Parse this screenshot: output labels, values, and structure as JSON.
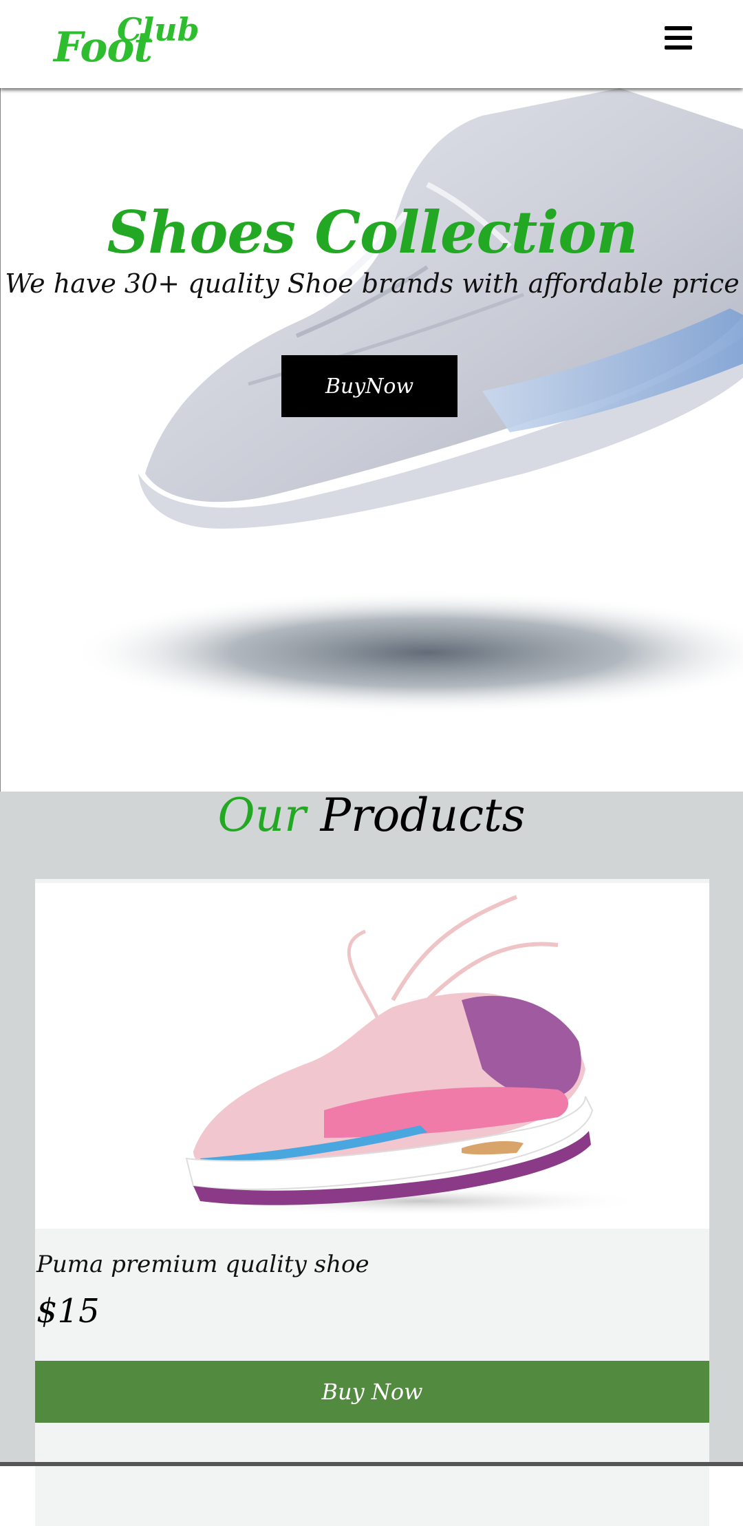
{
  "header": {
    "logo_foot": "Foot",
    "logo_club": "Club",
    "menu_icon": "hamburger-menu-icon"
  },
  "hero": {
    "title": "Shoes Collection",
    "subtitle": "We have 30+ quality Shoe brands with affordable price",
    "button_label": "BuyNow"
  },
  "products": {
    "title_word1": "Our",
    "title_word2": "Products",
    "items": [
      {
        "name": "Puma premium quality shoe",
        "price": "$15",
        "button_label": "Buy  Now"
      }
    ]
  },
  "colors": {
    "accent_green": "#22a822",
    "buy_button_green": "#528a40",
    "products_bg": "#d1d5d6"
  }
}
